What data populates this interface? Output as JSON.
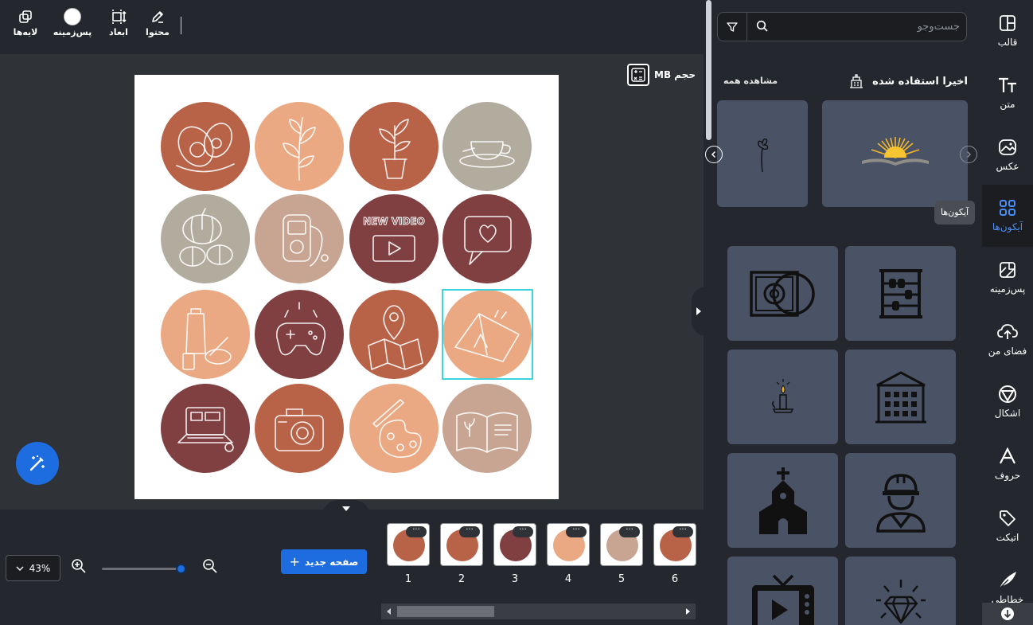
{
  "toolbar": {
    "items": [
      {
        "label": "محتوا",
        "icon": "edit-pen-icon"
      },
      {
        "label": "ابعاد",
        "icon": "resize-icon"
      },
      {
        "label": "پس‌زمینه",
        "icon": "background-color-icon"
      },
      {
        "label": "لایه‌ها",
        "icon": "layers-icon"
      }
    ],
    "background_swatch_color": "#ffffff"
  },
  "canvas": {
    "size_label": "حجم MB",
    "selection_color": "#3fd3e0",
    "circles": [
      {
        "color": "#b86247",
        "motif": "avocado"
      },
      {
        "color": "#eaa883",
        "motif": "plant-branch"
      },
      {
        "color": "#b86247",
        "motif": "potted-plant"
      },
      {
        "color": "#b2ac9e",
        "motif": "tea-cup"
      },
      {
        "color": "#b2ac9e",
        "motif": "pumpkins"
      },
      {
        "color": "#c8a593",
        "motif": "music-player"
      },
      {
        "color": "#803f41",
        "motif": "new-video",
        "text": "NEW VIDEO"
      },
      {
        "color": "#803f41",
        "motif": "heart-message"
      },
      {
        "color": "#eaa883",
        "motif": "cosmetics"
      },
      {
        "color": "#803f41",
        "motif": "game-controller"
      },
      {
        "color": "#b86247",
        "motif": "map-pin"
      },
      {
        "color": "#eaa883",
        "motif": "tent",
        "selected": true
      },
      {
        "color": "#803f41",
        "motif": "laptop"
      },
      {
        "color": "#b86247",
        "motif": "camera"
      },
      {
        "color": "#eaa883",
        "motif": "paint-palette"
      },
      {
        "color": "#c8a593",
        "motif": "open-book"
      }
    ]
  },
  "zoom": {
    "value": "43%"
  },
  "pages": {
    "new_page_label": "صفحه جدید",
    "thumbs": [
      {
        "num": "1",
        "color": "#b86247"
      },
      {
        "num": "2",
        "color": "#b86247"
      },
      {
        "num": "3",
        "color": "#803f41"
      },
      {
        "num": "4",
        "color": "#eaa883"
      },
      {
        "num": "5",
        "color": "#c8a593"
      },
      {
        "num": "6",
        "color": "#b86247"
      }
    ],
    "menu_glyph": "···"
  },
  "panel": {
    "search_placeholder": "جست‌وجو",
    "recent_title": "اخیرا استفاده شده",
    "view_all": "مشاهده همه",
    "recent": [
      {
        "name": "sunrise-book-icon"
      },
      {
        "name": "flower-sketch-icon"
      }
    ],
    "icons": [
      {
        "name": "abacus-icon"
      },
      {
        "name": "cd-player-icon"
      },
      {
        "name": "building-icon"
      },
      {
        "name": "candle-icon"
      },
      {
        "name": "construction-worker-icon"
      },
      {
        "name": "church-icon"
      },
      {
        "name": "diamond-icon"
      },
      {
        "name": "tv-icon"
      }
    ]
  },
  "sidebar": {
    "items": [
      {
        "label": "قالب",
        "icon": "template-icon"
      },
      {
        "label": "متن",
        "icon": "text-icon"
      },
      {
        "label": "عکس",
        "icon": "photo-icon"
      },
      {
        "label": "آیکون‌ها",
        "icon": "icons-grid-icon",
        "active": true
      },
      {
        "label": "پس‌زمینه",
        "icon": "background-icon"
      },
      {
        "label": "فضای من",
        "icon": "cloud-upload-icon"
      },
      {
        "label": "اشکال",
        "icon": "shapes-icon"
      },
      {
        "label": "حروف",
        "icon": "letters-icon"
      },
      {
        "label": "اتیکت",
        "icon": "sticker-tag-icon"
      },
      {
        "label": "خطاطی",
        "icon": "calligraphy-icon"
      }
    ],
    "tooltip": "آیکون‌ها",
    "active_color": "#4a8df6"
  }
}
